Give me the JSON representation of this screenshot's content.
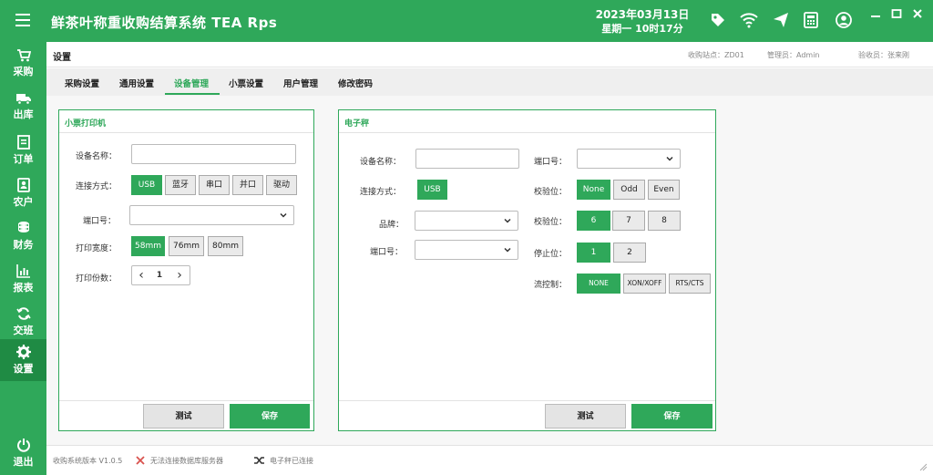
{
  "header": {
    "title": "鲜茶叶称重收购结算系统  TEA  Rps",
    "date": "2023年03月13日",
    "weekday_time": "星期一   10时17分"
  },
  "sidebar": {
    "items": [
      {
        "label": "采购",
        "icon": "cart-icon"
      },
      {
        "label": "出库",
        "icon": "truck-icon"
      },
      {
        "label": "订单",
        "icon": "order-icon"
      },
      {
        "label": "农户",
        "icon": "farmer-icon"
      },
      {
        "label": "财务",
        "icon": "coins-icon"
      },
      {
        "label": "报表",
        "icon": "chart-icon"
      },
      {
        "label": "交班",
        "icon": "shift-icon"
      },
      {
        "label": "设置",
        "icon": "gear-icon"
      }
    ],
    "logout": "退出",
    "active": "设置"
  },
  "page": {
    "title": "设置",
    "station": "收购站点：ZD01",
    "admin": "管理员：Admin",
    "inspector": "验收员：张来刚"
  },
  "tabs": [
    "采购设置",
    "通用设置",
    "设备管理",
    "小票设置",
    "用户管理",
    "修改密码"
  ],
  "active_tab": "设备管理",
  "printer": {
    "title": "小票打印机",
    "name_label": "设备名称：",
    "name_value": "",
    "conn_label": "连接方式：",
    "conn_options": [
      "USB",
      "蓝牙",
      "串口",
      "并口",
      "驱动"
    ],
    "conn_selected": "USB",
    "port_label": "端口号：",
    "port_value": "",
    "width_label": "打印宽度：",
    "width_options": [
      "58mm",
      "76mm",
      "80mm"
    ],
    "width_selected": "58mm",
    "copies_label": "打印份数：",
    "copies_value": "1",
    "test_btn": "测试",
    "save_btn": "保存"
  },
  "scale": {
    "title": "电子秤",
    "name_label": "设备名称：",
    "name_value": "",
    "conn_label": "连接方式：",
    "conn_value": "USB",
    "brand_label": "品牌：",
    "brand_value": "",
    "port_label_left": "端口号：",
    "port_left_value": "",
    "port_label_right": "端口号：",
    "port_right_value": "",
    "parity_label": "校验位：",
    "parity_options": [
      "None",
      "Odd",
      "Even"
    ],
    "parity_selected": "None",
    "databits_label": "校验位：",
    "databits_options": [
      "6",
      "7",
      "8"
    ],
    "databits_selected": "6",
    "stopbits_label": "停止位：",
    "stopbits_options": [
      "1",
      "2"
    ],
    "stopbits_selected": "1",
    "flow_label": "流控制：",
    "flow_options": [
      "NONE",
      "XON/XOFF",
      "RTS/CTS"
    ],
    "flow_selected": "NONE",
    "test_btn": "测试",
    "save_btn": "保存"
  },
  "status": {
    "version": "收购系统版本 V1.0.5",
    "db": "无法连接数据库服务器",
    "scale": "电子秤已连接"
  },
  "colors": {
    "accent": "#2fa85a",
    "accent_dark": "#1f8b44",
    "error": "#d9534f"
  }
}
